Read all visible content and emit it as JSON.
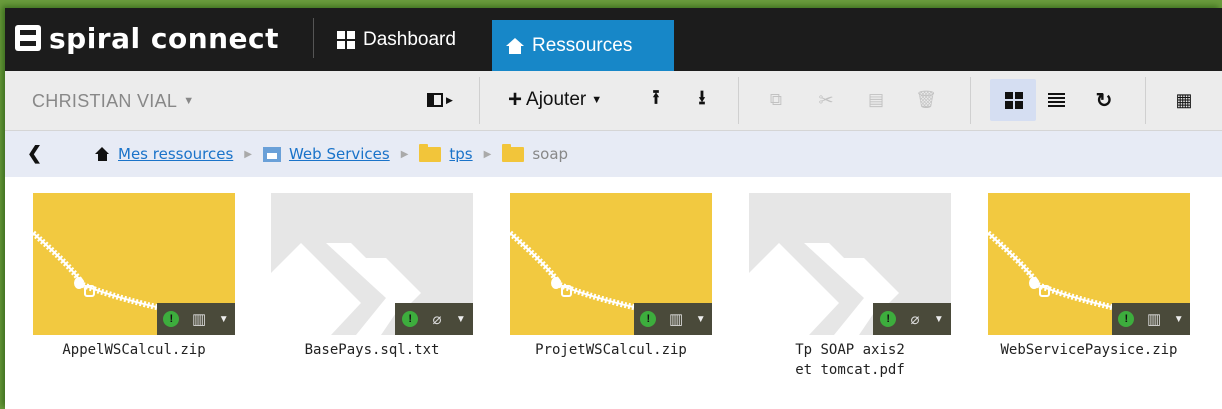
{
  "app": {
    "brand": "spiral connect",
    "tabs": [
      {
        "label": "Dashboard"
      },
      {
        "label": "Ressources",
        "active": true
      }
    ],
    "active_tab_color": "#1787c8"
  },
  "toolbar": {
    "user_name": "CHRISTIAN VIAL",
    "add_label": "Ajouter",
    "icons": [
      "panel-toggle-icon",
      "upload-icon",
      "download-icon",
      "copy-icon",
      "cut-icon",
      "paste-icon",
      "trash-icon",
      "grid-view-icon",
      "list-view-icon",
      "refresh-icon",
      "calendar-icon"
    ]
  },
  "breadcrumb": {
    "items": [
      {
        "label": "Mes ressources",
        "icon": "home-icon",
        "link": true
      },
      {
        "label": "Web Services",
        "icon": "web-services-icon",
        "link": true
      },
      {
        "label": "tps",
        "icon": "folder-icon",
        "link": true
      },
      {
        "label": "soap",
        "icon": "folder-icon",
        "link": false
      }
    ]
  },
  "files": [
    {
      "name": "AppelWSCalcul.zip",
      "type": "zip",
      "attachment_icon": "archive-icon"
    },
    {
      "name": "BasePays.sql.txt",
      "type": "doc",
      "attachment_icon": "paperclip-icon"
    },
    {
      "name": "ProjetWSCalcul.zip",
      "type": "zip",
      "attachment_icon": "archive-icon"
    },
    {
      "name": "Tp SOAP axis2 et tomcat.pdf",
      "type": "doc",
      "attachment_icon": "paperclip-icon"
    },
    {
      "name": "WebServicePaysice.zip",
      "type": "zip",
      "attachment_icon": "archive-icon"
    }
  ],
  "colors": {
    "zip_thumb": "#f2c940",
    "doc_thumb": "#e6e6e6",
    "status_ok": "#3dad3d",
    "link": "#1a73c9"
  }
}
